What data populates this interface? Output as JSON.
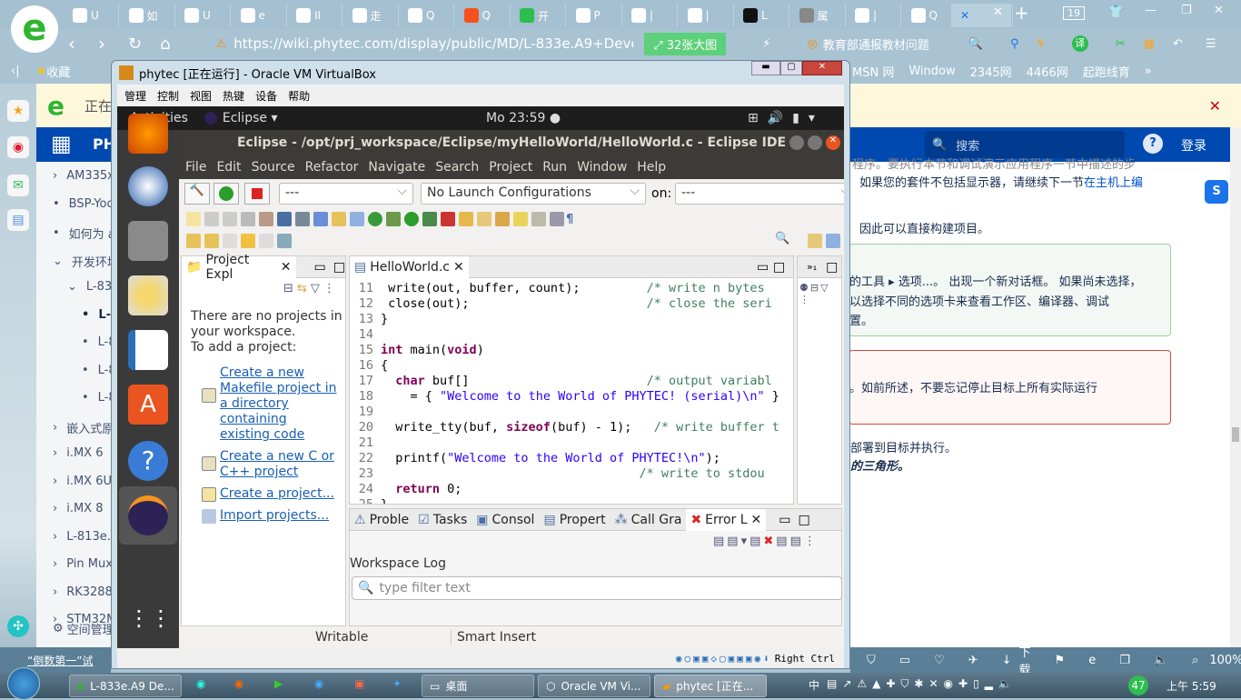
{
  "browser": {
    "tabs": [
      "U",
      "如",
      "U",
      "e",
      "II",
      "走",
      "Q",
      "Q",
      "开",
      "P",
      "|",
      "|",
      "L",
      "属",
      "|",
      "Q",
      "|"
    ],
    "tab_count": "19",
    "url": "https://wiki.phytec.com/display/public/MD/L-833e.A9+Develop",
    "big_images": "32张大图",
    "search_hint": "教育部通报教材问题",
    "bookmarks": {
      "favorites": "收藏",
      "items": [
        "MSN 网",
        "Window",
        "2345网",
        "4466网",
        "起跑线育"
      ],
      "more": "»"
    },
    "notice": "正在",
    "status_items": [
      "下载",
      "100%"
    ],
    "status_left": "“倒数第一”试"
  },
  "wiki": {
    "logo": "PH",
    "search_placeholder": "搜索",
    "login": "登录",
    "nav": [
      {
        "label": "AM335x",
        "arrow": "›",
        "indent": 0
      },
      {
        "label": "BSP-Yoc",
        "arrow": "•",
        "indent": 0
      },
      {
        "label": "如何为 a",
        "arrow": "•",
        "indent": 0
      },
      {
        "label": "开发环境",
        "arrow": "⌄",
        "indent": 0
      },
      {
        "label": "L-833",
        "arrow": "⌄",
        "indent": 1
      },
      {
        "label": "L-8",
        "arrow": "•",
        "indent": 2,
        "bold": true
      },
      {
        "label": "L-8",
        "arrow": "•",
        "indent": 2
      },
      {
        "label": "L-8",
        "arrow": "•",
        "indent": 2
      },
      {
        "label": "L-8",
        "arrow": "•",
        "indent": 2
      },
      {
        "label": "嵌入式原",
        "arrow": "›",
        "indent": 0
      },
      {
        "label": "i.MX 6",
        "arrow": "›",
        "indent": 0
      },
      {
        "label": "i.MX 6U",
        "arrow": "›",
        "indent": 0
      },
      {
        "label": "i.MX 8",
        "arrow": "›",
        "indent": 0
      },
      {
        "label": "L-813e.A",
        "arrow": "›",
        "indent": 0
      },
      {
        "label": "Pin Mux",
        "arrow": "›",
        "indent": 0
      },
      {
        "label": "RK3288",
        "arrow": "›",
        "indent": 0
      },
      {
        "label": "STM32M",
        "arrow": "›",
        "indent": 0
      }
    ],
    "space_admin": "空间管理",
    "content": {
      "p1a": "程序。要执行本节和调试演示应用程序一节中描述的步",
      "p1b": "如果您的套件不包括显示器，请继续下一节",
      "p1link": "在主机上编",
      "p2": "因此可以直接构建项目。",
      "tip1": "的工具 ▸ 选项...。 出现一个新对话框。 如果尚未选择，",
      "tip2": "以选择不同的选项卡来查看工作区、编译器、调试",
      "tip3": "置。",
      "warn": "。如前所述，不要忘记停止目标上所有实际运行",
      "p3": "部署到目标并执行。",
      "p4": "的三角形。"
    }
  },
  "vbox": {
    "title": "phytec [正在运行] - Oracle VM VirtualBox",
    "menu": [
      "管理",
      "控制",
      "视图",
      "热键",
      "设备",
      "帮助"
    ],
    "host_key": "Right Ctrl"
  },
  "ubuntu": {
    "activities": "Activities",
    "app": "Eclipse ▾",
    "clock": "Mo 23:59 ●"
  },
  "eclipse": {
    "title": "Eclipse - /opt/prj_workspace/Eclipse/myHelloWorld/HelloWorld.c - Eclipse IDE",
    "menu": [
      "File",
      "Edit",
      "Source",
      "Refactor",
      "Navigate",
      "Search",
      "Project",
      "Run",
      "Window",
      "Help"
    ],
    "launch_mode": "---",
    "launch_config": "No Launch Configurations",
    "on_label": "on:",
    "target": "---",
    "project_explorer": {
      "tab": "Project Expl",
      "empty1": "There are no projects in",
      "empty2": "your workspace.",
      "empty3": "To add a project:",
      "links": [
        "Create a new Makefile project in a directory containing existing code",
        "Create a new C or C++ project",
        "Create a project...",
        "Import projects..."
      ]
    },
    "editor_tab": "HelloWorld.c",
    "code": [
      {
        "n": "11",
        "tokens": [
          [
            "",
            " write(out, buffer, count);         "
          ],
          [
            "cm",
            "/* write n bytes"
          ]
        ]
      },
      {
        "n": "12",
        "tokens": [
          [
            "",
            " close(out);                        "
          ],
          [
            "cm",
            "/* close the seri"
          ]
        ]
      },
      {
        "n": "13",
        "tokens": [
          [
            "",
            "}"
          ]
        ]
      },
      {
        "n": "14",
        "tokens": []
      },
      {
        "n": "15",
        "tokens": [
          [
            "kw",
            "int"
          ],
          [
            "",
            " main("
          ],
          [
            "kw",
            "void"
          ],
          [
            "",
            ")"
          ]
        ]
      },
      {
        "n": "16",
        "tokens": [
          [
            "",
            "{"
          ]
        ]
      },
      {
        "n": "17",
        "tokens": [
          [
            "",
            "  "
          ],
          [
            "kw",
            "char"
          ],
          [
            "",
            " buf[]                        "
          ],
          [
            "cm",
            "/* output variabl"
          ]
        ]
      },
      {
        "n": "18",
        "tokens": [
          [
            "",
            "    = { "
          ],
          [
            "str",
            "\"Welcome to the World of PHYTEC! (serial)\\n\""
          ],
          [
            "",
            " }"
          ]
        ]
      },
      {
        "n": "19",
        "tokens": []
      },
      {
        "n": "20",
        "tokens": [
          [
            "",
            "  write_tty(buf, "
          ],
          [
            "kw",
            "sizeof"
          ],
          [
            "",
            "(buf) - 1);   "
          ],
          [
            "cm",
            "/* write buffer t"
          ]
        ]
      },
      {
        "n": "21",
        "tokens": []
      },
      {
        "n": "22",
        "tokens": [
          [
            "",
            "  printf("
          ],
          [
            "str",
            "\"Welcome to the World of PHYTEC!\\n\""
          ],
          [
            "",
            ");"
          ]
        ]
      },
      {
        "n": "23",
        "tokens": [
          [
            "",
            "                                   "
          ],
          [
            "cm",
            "/* write to stdou"
          ]
        ]
      },
      {
        "n": "24",
        "tokens": [
          [
            "",
            "  "
          ],
          [
            "kw",
            "return"
          ],
          [
            "",
            " 0;"
          ]
        ]
      },
      {
        "n": "25",
        "tokens": [
          [
            "",
            "}"
          ]
        ]
      },
      {
        "n": "26",
        "tokens": []
      }
    ],
    "bottom_tabs": [
      "Proble",
      "Tasks",
      "Consol",
      "Propert",
      "Call Gra",
      "Error L"
    ],
    "workspace_log": "Workspace Log",
    "filter_placeholder": "type filter text",
    "status": [
      "Writable",
      "Smart Insert"
    ]
  },
  "taskbar": {
    "items": [
      "L-833e.A9 De...",
      "桌面",
      "Oracle VM Vi...",
      "phytec [正在..."
    ],
    "ime": "中",
    "badge": "47",
    "clock": "上午 5:59"
  },
  "colors": {
    "wiki_header": "#0049b0",
    "eclipse_dark": "#3c3b37",
    "keyword": "#7f0055",
    "string": "#2a00ff",
    "comment": "#3f7f5f",
    "link": "#1a5fb4"
  }
}
